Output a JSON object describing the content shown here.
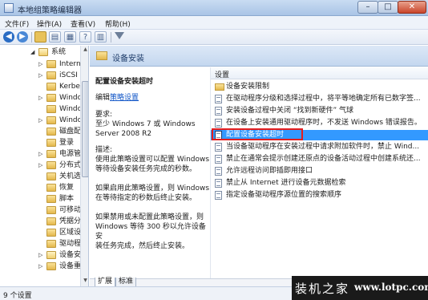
{
  "window": {
    "title": "本地组策略编辑器",
    "min": "–",
    "max": "□",
    "close": "✕"
  },
  "menu": [
    "文件(F)",
    "操作(A)",
    "查看(V)",
    "帮助(H)"
  ],
  "toolbar": {
    "icons": [
      "back-icon",
      "forward-icon",
      "up-folder-icon",
      "show-tree-icon",
      "properties-icon",
      "help-icon",
      "view-icon",
      "filter-icon"
    ]
  },
  "tree": {
    "items": [
      {
        "label": "系统",
        "expander": "◢"
      },
      {
        "label": "Intern",
        "expander": "▷"
      },
      {
        "label": "iSCSI",
        "expander": "▷"
      },
      {
        "label": "Kerbe",
        "expander": ""
      },
      {
        "label": "Windo",
        "expander": "▷"
      },
      {
        "label": "Windo",
        "expander": ""
      },
      {
        "label": "Windo",
        "expander": "▷"
      },
      {
        "label": "磁盘配",
        "expander": ""
      },
      {
        "label": "登录",
        "expander": ""
      },
      {
        "label": "电源管",
        "expander": "▷"
      },
      {
        "label": "分布式",
        "expander": "▷"
      },
      {
        "label": "关机选",
        "expander": ""
      },
      {
        "label": "恢复",
        "expander": ""
      },
      {
        "label": "脚本",
        "expander": ""
      },
      {
        "label": "可移动",
        "expander": ""
      },
      {
        "label": "凭据分",
        "expander": ""
      },
      {
        "label": "区域设",
        "expander": ""
      },
      {
        "label": "驱动程",
        "expander": ""
      },
      {
        "label": "设备安",
        "expander": "▷"
      },
      {
        "label": "设备重",
        "expander": "▷"
      }
    ]
  },
  "content": {
    "header_title": "设备安装",
    "description": {
      "title": "配置设备安装超时",
      "edit_prefix": "编辑",
      "edit_link": "策略设置",
      "requirements": [
        "要求:",
        "至少 Windows 7 或 Windows",
        "Server 2008 R2"
      ],
      "paragraphs": [
        [
          "描述:",
          "使用此策略设置可以配置 Windows",
          "等待设备安装任务完成的秒数。"
        ],
        [
          "如果启用此策略设置，则 Windows",
          "在等待指定的秒数后终止安装。"
        ],
        [
          "如果禁用或未配置此策略设置，则",
          "Windows 等待 300 秒以允许设备安",
          "装任务完成，然后终止安装。"
        ]
      ]
    },
    "list": {
      "column_header": "设置",
      "rows": [
        {
          "label": "设备安装限制",
          "icon": "folder-icon",
          "selected": false
        },
        {
          "label": "在驱动程序分级和选择过程中，将平等地确定所有已数字签...",
          "icon": "policy-icon",
          "selected": false
        },
        {
          "label": "安装设备过程中关闭 “找到新硬件” 气球",
          "icon": "policy-icon",
          "selected": false
        },
        {
          "label": "在设备上安装通用驱动程序时，不发送 Windows 错误报告。",
          "icon": "policy-icon",
          "selected": false
        },
        {
          "label": "配置设备安装超时",
          "icon": "policy-icon",
          "selected": true
        },
        {
          "label": "当设备驱动程序在安装过程中请求附加软件时，禁止 Wind...",
          "icon": "policy-icon",
          "selected": false
        },
        {
          "label": "禁止在通常会提示创建还原点的设备活动过程中创建系统还...",
          "icon": "policy-icon",
          "selected": false
        },
        {
          "label": "允许远程访问即插即用接口",
          "icon": "policy-icon",
          "selected": false
        },
        {
          "label": "禁止从 Internet 进行设备元数据检索",
          "icon": "policy-icon",
          "selected": false
        },
        {
          "label": "指定设备驱动程序源位置的搜索顺序",
          "icon": "policy-icon",
          "selected": false
        }
      ]
    },
    "tabs": [
      "扩展",
      "标准"
    ]
  },
  "status": {
    "text": "9 个设置"
  },
  "watermark": {
    "brand": "装机之家",
    "url": "www.lotpc.com"
  },
  "colors": {
    "selection": "#3399ff",
    "highlight_box": "#e41d1d",
    "link": "#1458c8"
  }
}
